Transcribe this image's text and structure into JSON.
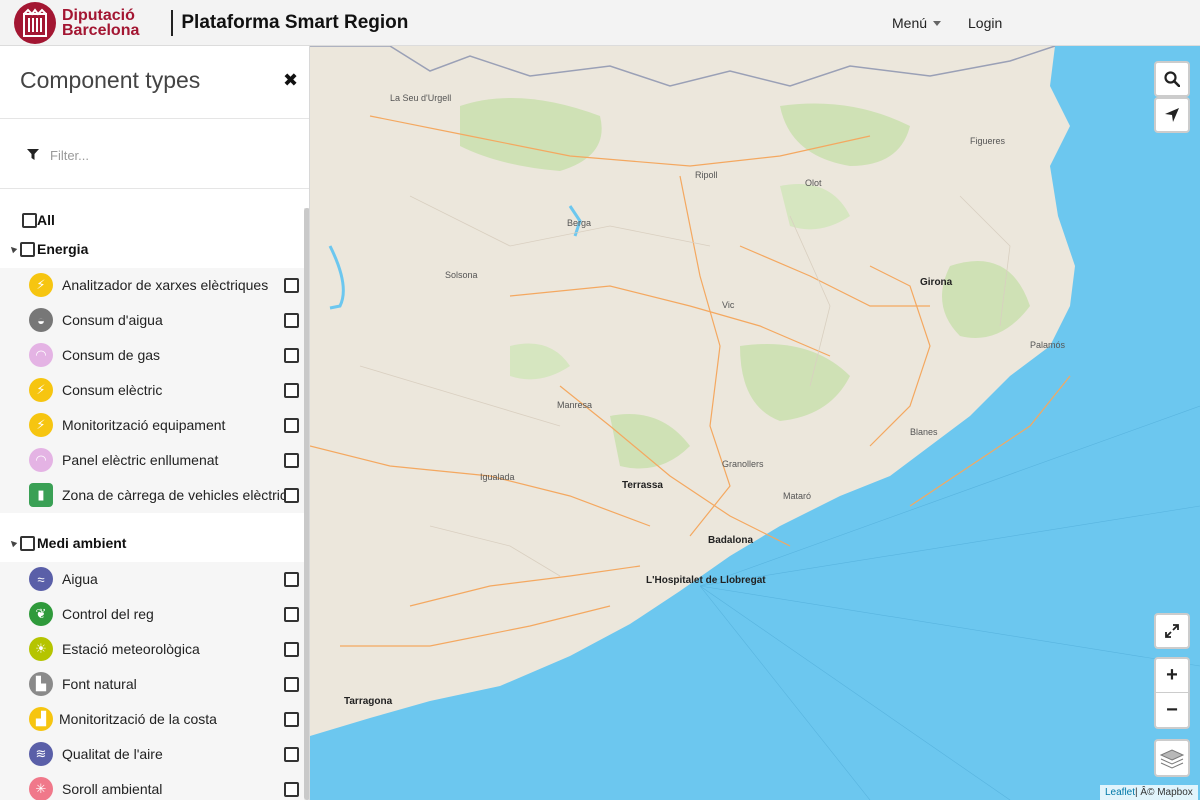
{
  "header": {
    "logo_line1": "Diputació",
    "logo_line2": "Barcelona",
    "app_title": "Plataforma Smart Region",
    "menu_label": "Menú",
    "login_label": "Login"
  },
  "sidebar": {
    "title": "Component types",
    "close_glyph": "✖",
    "filter_placeholder": "Filter...",
    "all_label": "All",
    "groups": [
      {
        "label": "Energia",
        "items": [
          {
            "label": "Analitzador de xarxes elèctriques",
            "icon": "lightning-icon",
            "color": "#f6c510",
            "glyph": "⚡"
          },
          {
            "label": "Consum d'aigua",
            "icon": "water-tap-icon",
            "color": "#777777",
            "glyph": "◒"
          },
          {
            "label": "Consum de gas",
            "icon": "wifi-signal-icon",
            "color": "#e4b3e4",
            "glyph": "◠"
          },
          {
            "label": "Consum elèctric",
            "icon": "lightning-icon",
            "color": "#f6c510",
            "glyph": "⚡"
          },
          {
            "label": "Monitorització equipament",
            "icon": "lightning-icon",
            "color": "#f6c510",
            "glyph": "⚡"
          },
          {
            "label": "Panel elèctric enllumenat",
            "icon": "wifi-signal-icon",
            "color": "#e4b3e4",
            "glyph": "◠"
          },
          {
            "label": "Zona de càrrega de vehicles elèctrics",
            "icon": "charging-station-icon",
            "color": "#3aa055",
            "glyph": "▮"
          }
        ]
      },
      {
        "label": "Medi ambient",
        "items": [
          {
            "label": "Aigua",
            "icon": "water-waves-icon",
            "color": "#5a5fa8",
            "glyph": "≈"
          },
          {
            "label": "Control del reg",
            "icon": "irrigation-icon",
            "color": "#2f9a3b",
            "glyph": "❦"
          },
          {
            "label": "Estació meteorològica",
            "icon": "sun-icon",
            "color": "#b5c400",
            "glyph": "☀"
          },
          {
            "label": "Font natural",
            "icon": "fountain-icon",
            "color": "#8a8a8a",
            "glyph": "▙"
          },
          {
            "label": "Monitorització de la costa",
            "icon": "coast-icon",
            "color": "#f6c510",
            "glyph": "▟"
          },
          {
            "label": "Qualitat de l'aire",
            "icon": "air-quality-icon",
            "color": "#5a5fa8",
            "glyph": "≋"
          },
          {
            "label": "Soroll ambiental",
            "icon": "noise-icon",
            "color": "#f0788a",
            "glyph": "✳"
          }
        ]
      }
    ]
  },
  "map": {
    "places": [
      {
        "name": "La Seu d'Urgell"
      },
      {
        "name": "Ripoll"
      },
      {
        "name": "Olot"
      },
      {
        "name": "Figueres"
      },
      {
        "name": "Girona"
      },
      {
        "name": "Vic"
      },
      {
        "name": "Manresa"
      },
      {
        "name": "Terrassa"
      },
      {
        "name": "Badalona"
      },
      {
        "name": "L'Hospitalet de Llobregat"
      },
      {
        "name": "Mataró"
      },
      {
        "name": "Granollers"
      },
      {
        "name": "Tarragona"
      },
      {
        "name": "Blanes"
      },
      {
        "name": "Solsona"
      },
      {
        "name": "Berga"
      },
      {
        "name": "Igualada"
      },
      {
        "name": "Palamós"
      }
    ],
    "attribution_link": "Leaflet",
    "attribution_text": " | Â© Mapbox",
    "zoom_in": "+",
    "zoom_out": "−"
  }
}
